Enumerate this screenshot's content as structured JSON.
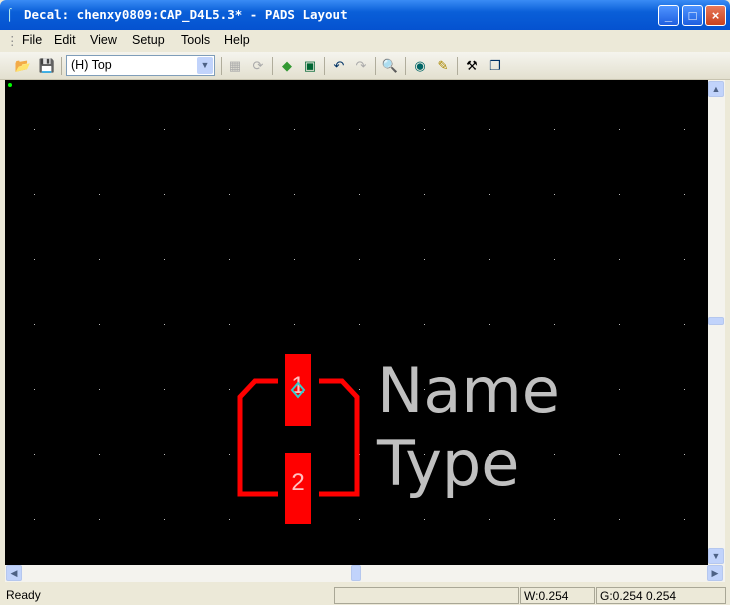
{
  "window": {
    "title": "Decal: chenxy0809:CAP_D4L5.3* - PADS Layout",
    "minimize": "_",
    "maximize": "□",
    "close": "×"
  },
  "menu": [
    "File",
    "Edit",
    "View",
    "Setup",
    "Tools",
    "Help"
  ],
  "toolbar": {
    "layer_select": "(H) Top",
    "icons": [
      "open-icon",
      "save-icon",
      "properties-icon",
      "refresh-icon",
      "add-terminal-icon",
      "decal-wizard-icon",
      "undo-icon",
      "redo-icon",
      "zoom-icon",
      "display-colors-icon",
      "clean-up-icon",
      "attribute-icon",
      "layers-icon"
    ]
  },
  "canvas": {
    "background": "#000000",
    "pad_color": "#ff0000",
    "silk_color": "#ff0000",
    "label_color": "#c0c0c0",
    "pads": [
      "1",
      "2"
    ],
    "labels": [
      "Name",
      "Type"
    ]
  },
  "status": {
    "text": "Ready",
    "width": "W:0.254",
    "grid": "G:0.254 0.254"
  }
}
